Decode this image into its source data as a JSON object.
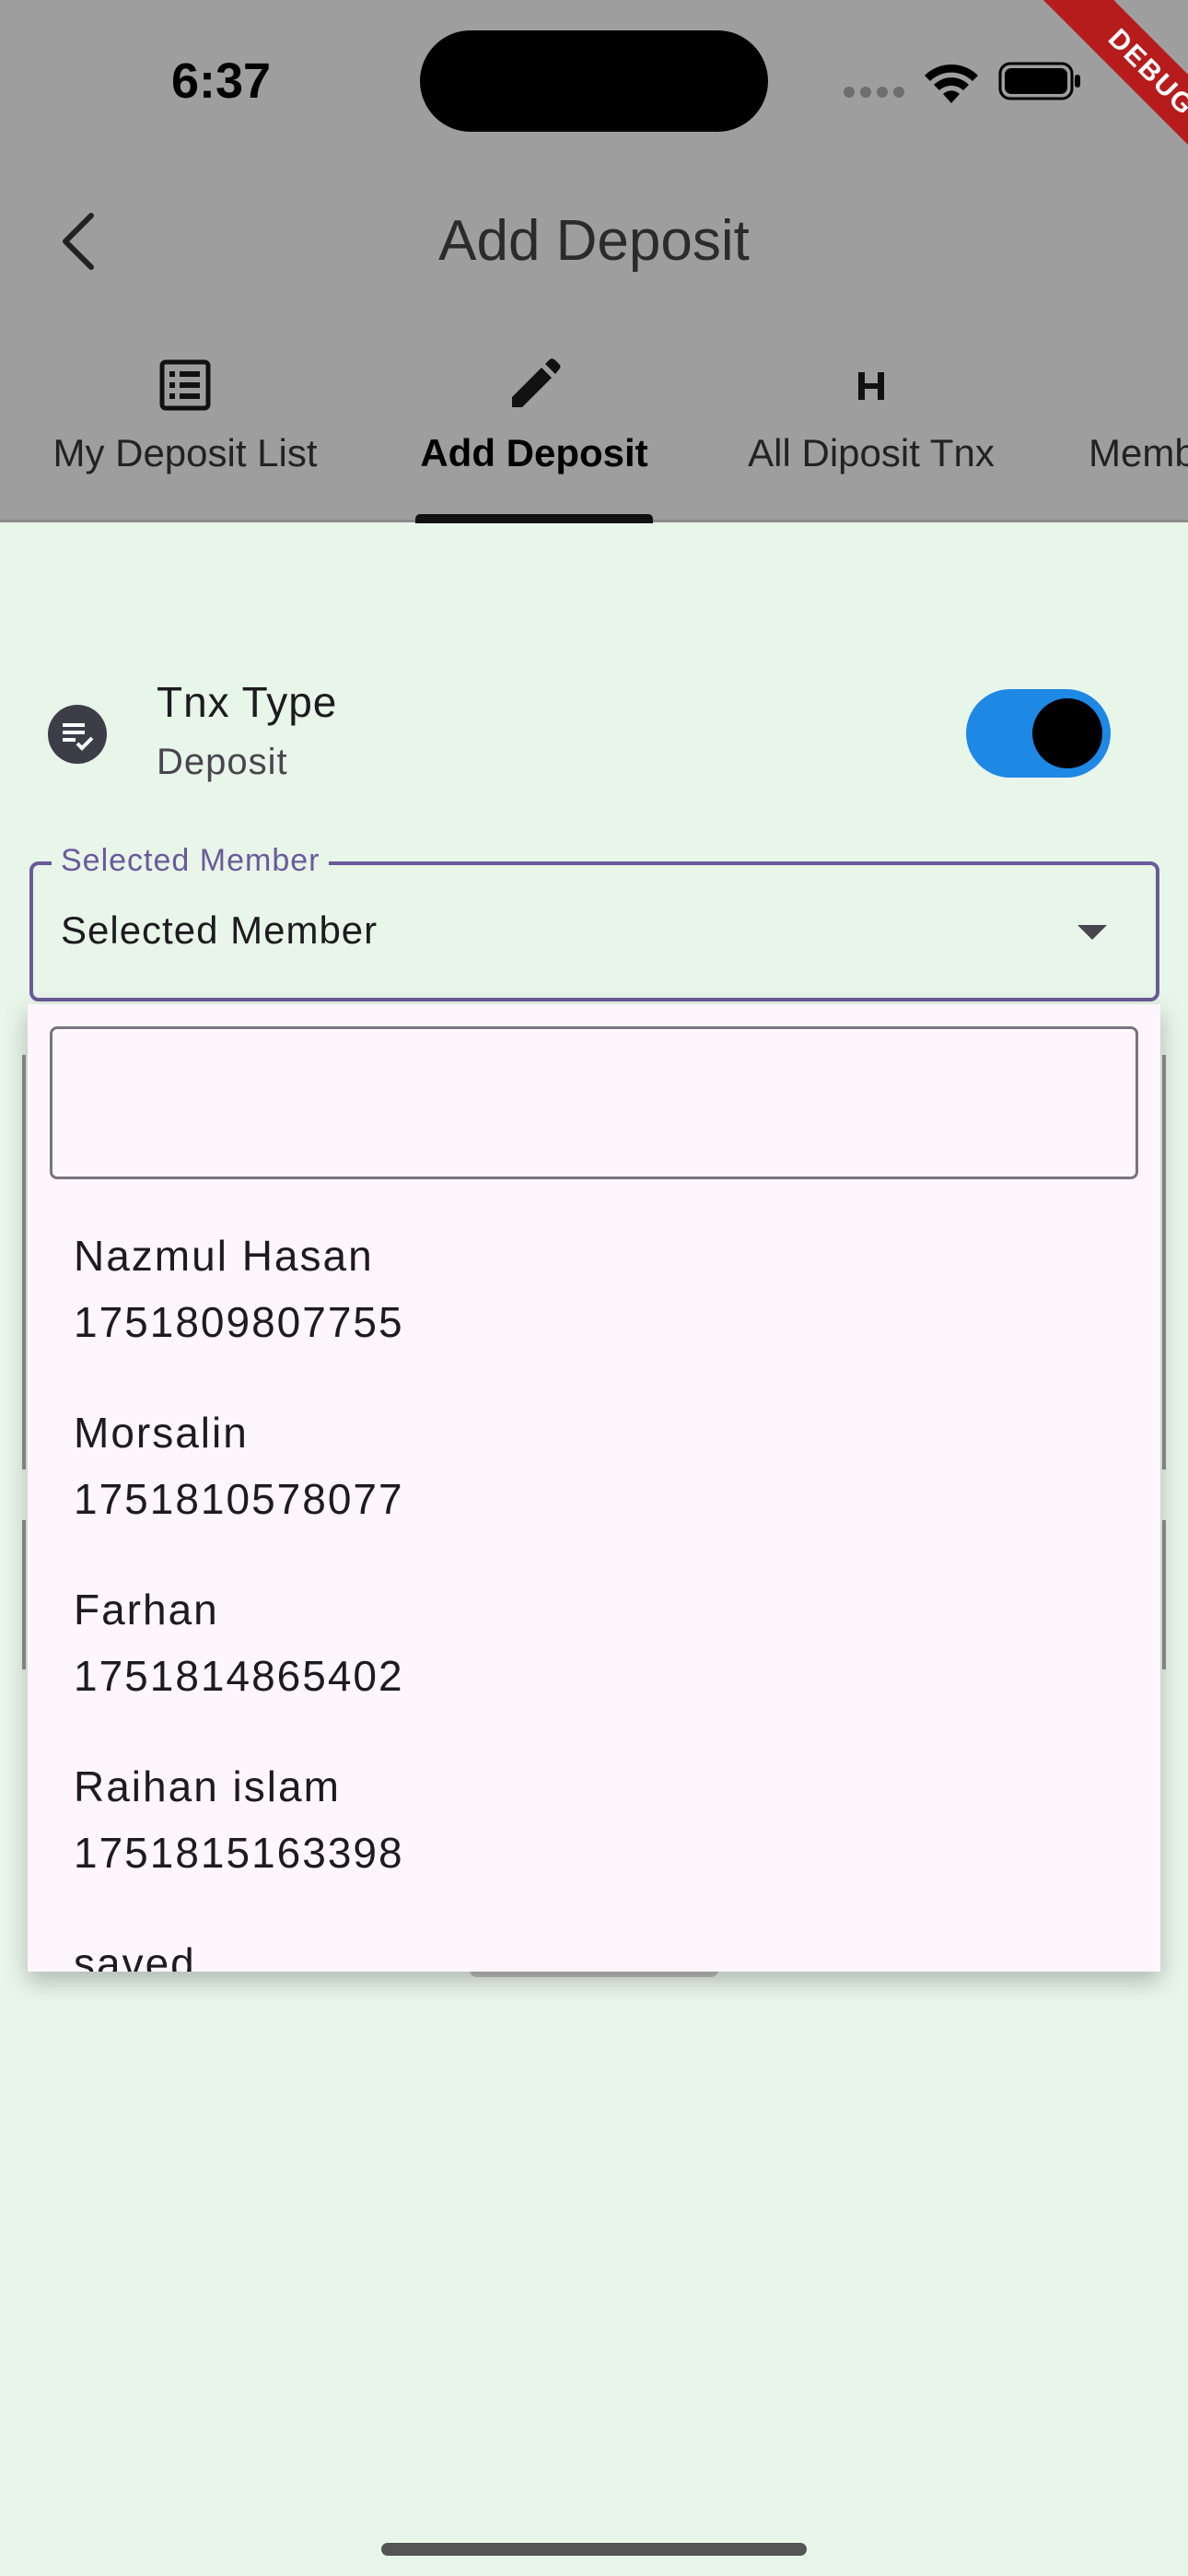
{
  "status_bar": {
    "time": "6:37",
    "debug_label": "DEBUG"
  },
  "app_bar": {
    "title": "Add Deposit",
    "back_icon": "chevron-left-icon"
  },
  "tabs": [
    {
      "label": "My Deposit List",
      "icon": "list-icon",
      "active": false
    },
    {
      "label": "Add Deposit",
      "icon": "pencil-icon",
      "active": true
    },
    {
      "label": "All Diposit Tnx",
      "icon": "letter-h-icon",
      "active": false
    },
    {
      "label": "Memb",
      "icon": "",
      "active": false
    }
  ],
  "tnx_type": {
    "title": "Tnx Type",
    "subtitle": "Deposit",
    "toggle_on": true
  },
  "member_field": {
    "label": "Selected Member",
    "value": "Selected Member"
  },
  "dropdown": {
    "search_value": "",
    "items": [
      {
        "name": "Nazmul Hasan",
        "phone": "1751809807755"
      },
      {
        "name": "Morsalin",
        "phone": "1751810578077"
      },
      {
        "name": "Farhan",
        "phone": "1751814865402"
      },
      {
        "name": "Raihan islam",
        "phone": "1751815163398"
      },
      {
        "name": "saved",
        "phone": ""
      }
    ]
  },
  "colors": {
    "background": "#E8F5E9",
    "overlay": "#9E9E9E",
    "toggle_track": "#1E88E5",
    "field_border": "#6A5A9A",
    "popup_bg": "#FDF6FC",
    "debug_ribbon": "#B71C1C"
  }
}
